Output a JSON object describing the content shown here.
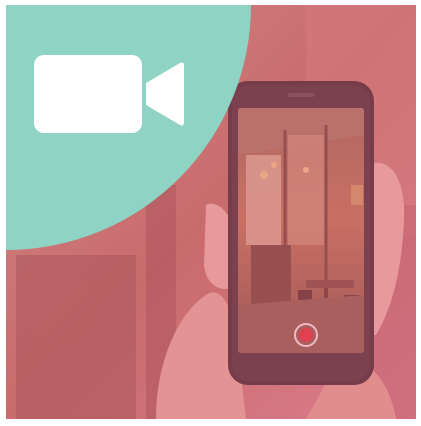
{
  "scene": {
    "subject": "phone-recording-cafe-interior",
    "overlay_color": "#e0677f",
    "circle_color": "#8fd3c4",
    "icon": "video-camera-icon",
    "record_indicator_color": "#e3202b"
  }
}
